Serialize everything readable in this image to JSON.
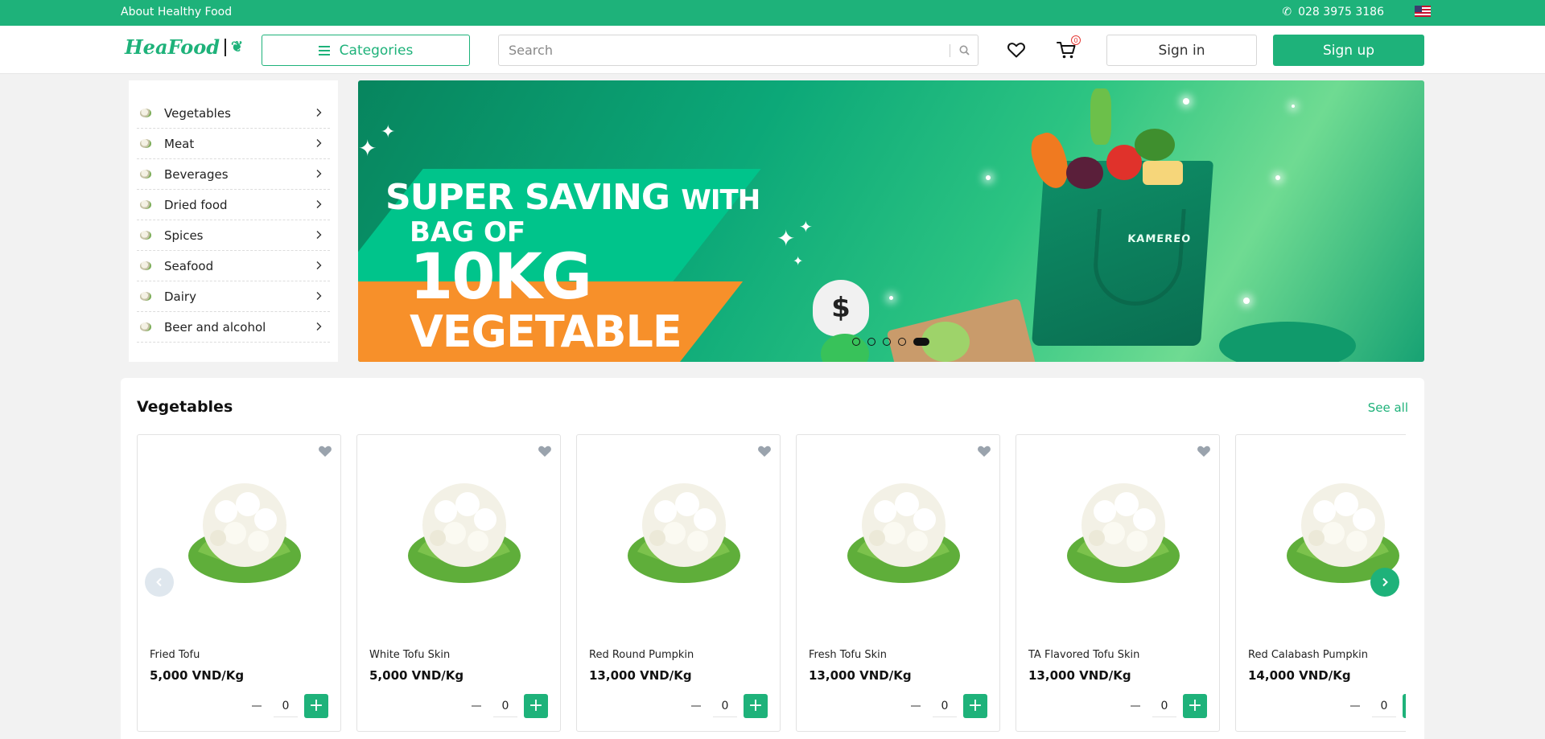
{
  "topbar": {
    "about": "About Healthy Food",
    "phone": "028 3975 3186",
    "language_flag": "us-flag-icon"
  },
  "header": {
    "logo_text": "HeaFood",
    "categories_label": "Categories",
    "search_placeholder": "Search",
    "cart_count": "0",
    "sign_in_label": "Sign in",
    "sign_up_label": "Sign up"
  },
  "colors": {
    "brand": "#1eb27a",
    "topbar": "#1eb27a",
    "badge": "#e53935"
  },
  "sidebar": {
    "items": [
      {
        "label": "Vegetables"
      },
      {
        "label": "Meat"
      },
      {
        "label": "Beverages"
      },
      {
        "label": "Dried food"
      },
      {
        "label": "Spices"
      },
      {
        "label": "Seafood"
      },
      {
        "label": "Dairy"
      },
      {
        "label": "Beer and alcohol"
      }
    ]
  },
  "banner": {
    "line1": "SUPER SAVING",
    "line1_small": "WITH",
    "line2": "BAG OF",
    "line3": "10KG",
    "line4": "VEGETABLE",
    "bag_brand": "KAMEREO",
    "slide_count": 5,
    "active_slide": 5
  },
  "vegetables_section": {
    "title": "Vegetables",
    "see_all": "See all",
    "products": [
      {
        "name": "Fried Tofu",
        "price": "5,000 VND/Kg",
        "qty": "0"
      },
      {
        "name": "White Tofu Skin",
        "price": "5,000 VND/Kg",
        "qty": "0"
      },
      {
        "name": "Red Round Pumpkin",
        "price": "13,000 VND/Kg",
        "qty": "0"
      },
      {
        "name": "Fresh Tofu Skin",
        "price": "13,000 VND/Kg",
        "qty": "0"
      },
      {
        "name": "TA Flavored Tofu Skin",
        "price": "13,000 VND/Kg",
        "qty": "0"
      },
      {
        "name": "Red Calabash Pumpkin",
        "price": "14,000 VND/Kg",
        "qty": "0"
      }
    ]
  }
}
